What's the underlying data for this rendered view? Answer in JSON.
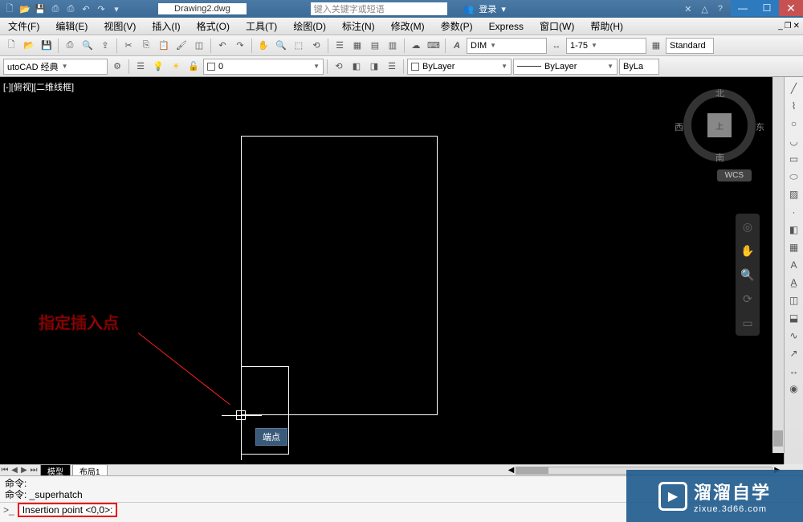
{
  "titlebar": {
    "doc_title": "Drawing2.dwg",
    "search_placeholder": "键入关键字或短语",
    "login_label": "登录",
    "sys": {
      "min": "—",
      "max": "☐",
      "close": "✕"
    }
  },
  "menubar": {
    "items": [
      {
        "label": "文件(F)"
      },
      {
        "label": "编辑(E)"
      },
      {
        "label": "视图(V)"
      },
      {
        "label": "插入(I)"
      },
      {
        "label": "格式(O)"
      },
      {
        "label": "工具(T)"
      },
      {
        "label": "绘图(D)"
      },
      {
        "label": "标注(N)"
      },
      {
        "label": "修改(M)"
      },
      {
        "label": "参数(P)"
      },
      {
        "label": "Express"
      },
      {
        "label": "窗口(W)"
      },
      {
        "label": "帮助(H)"
      }
    ]
  },
  "toolbar1": {
    "dim_style": "DIM",
    "dim_scale": "1-75",
    "text_style": "Standard"
  },
  "toolbar2": {
    "workspace": "utoCAD 经典",
    "layer_state": "0",
    "color": "ByLayer",
    "linetype": "ByLayer",
    "lineweight": "ByLa"
  },
  "viewport": {
    "label": "[-][俯视][二维线框]",
    "tooltip": "端点",
    "annotation": "指定插入点",
    "navcube": {
      "n": "北",
      "s": "南",
      "e": "东",
      "w": "西",
      "face": "上"
    },
    "wcs": "WCS"
  },
  "tabs": {
    "model": "模型",
    "layout1": "布局1"
  },
  "command": {
    "line1": "命令:",
    "line2": "命令: _superhatch",
    "prompt": ">_",
    "input": "Insertion point <0,0>:"
  },
  "watermark": {
    "title": "溜溜自学",
    "url": "zixue.3d66.com"
  }
}
